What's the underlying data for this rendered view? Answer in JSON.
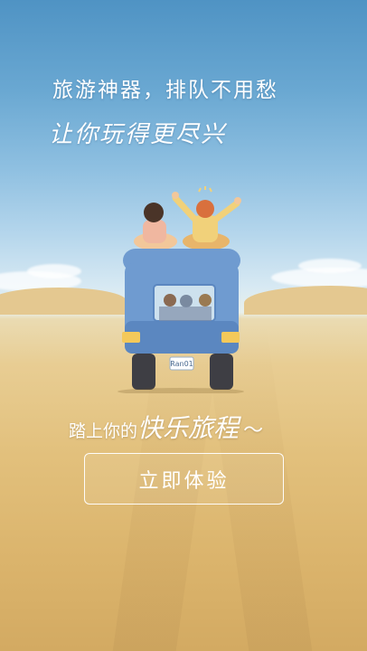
{
  "splash": {
    "headline": "旅游神器，排队不用愁",
    "subline": "让你玩得更尽兴",
    "tagline_prefix": "踏上你的",
    "tagline_highlight": "快乐旅程",
    "tagline_suffix": "～",
    "cta_label": "立即体验",
    "license_plate": "Ran01"
  },
  "colors": {
    "sky_top": "#4f93c4",
    "sand": "#e2c07c",
    "truck_body": "#6f9bd0",
    "truck_bumper": "#5b87c0",
    "text": "#ffffff"
  },
  "icons": [
    "travelers-truck-illustration"
  ]
}
